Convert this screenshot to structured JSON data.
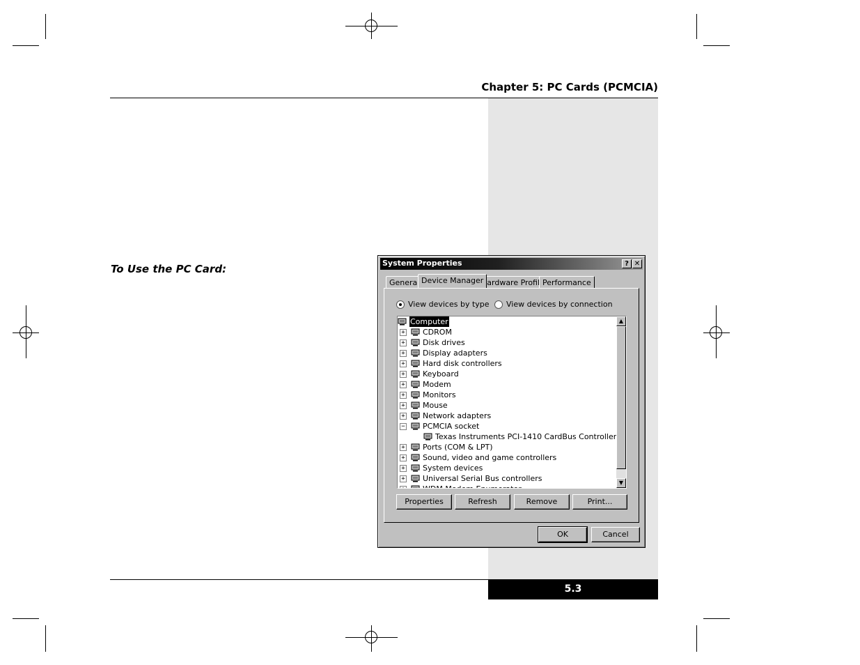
{
  "header": {
    "chapter_title": "Chapter 5: PC Cards (PCMCIA)"
  },
  "subheading": "To Use the PC Card:",
  "footer": {
    "page_number": "5.3"
  },
  "dialog": {
    "title": "System Properties",
    "help_button": "?",
    "close_button": "✕",
    "tabs": [
      "General",
      "Device Manager",
      "Hardware Profiles",
      "Performance"
    ],
    "active_tab": "Device Manager",
    "radio_by_type": "View devices by type",
    "radio_by_connection": "View devices by connection",
    "selected_radio": "View devices by type",
    "tree": [
      {
        "label": "Computer",
        "level": 0,
        "expander": "",
        "icon": "computer-icon",
        "selected": true
      },
      {
        "label": "CDROM",
        "level": 1,
        "expander": "+",
        "icon": "cdrom-icon"
      },
      {
        "label": "Disk drives",
        "level": 1,
        "expander": "+",
        "icon": "disk-drive-icon"
      },
      {
        "label": "Display adapters",
        "level": 1,
        "expander": "+",
        "icon": "display-adapter-icon"
      },
      {
        "label": "Hard disk controllers",
        "level": 1,
        "expander": "+",
        "icon": "hard-disk-controller-icon"
      },
      {
        "label": "Keyboard",
        "level": 1,
        "expander": "+",
        "icon": "keyboard-icon"
      },
      {
        "label": "Modem",
        "level": 1,
        "expander": "+",
        "icon": "modem-icon"
      },
      {
        "label": "Monitors",
        "level": 1,
        "expander": "+",
        "icon": "monitor-icon"
      },
      {
        "label": "Mouse",
        "level": 1,
        "expander": "+",
        "icon": "mouse-icon"
      },
      {
        "label": "Network adapters",
        "level": 1,
        "expander": "+",
        "icon": "network-adapter-icon"
      },
      {
        "label": "PCMCIA socket",
        "level": 1,
        "expander": "−",
        "icon": "pcmcia-icon"
      },
      {
        "label": "Texas Instruments PCI-1410 CardBus Controller",
        "level": 2,
        "expander": "",
        "icon": "pcmcia-card-icon"
      },
      {
        "label": "Ports (COM & LPT)",
        "level": 1,
        "expander": "+",
        "icon": "port-icon"
      },
      {
        "label": "Sound, video and game controllers",
        "level": 1,
        "expander": "+",
        "icon": "sound-icon"
      },
      {
        "label": "System devices",
        "level": 1,
        "expander": "+",
        "icon": "system-device-icon"
      },
      {
        "label": "Universal Serial Bus controllers",
        "level": 1,
        "expander": "+",
        "icon": "usb-icon"
      },
      {
        "label": "WDM Modem Enumerator",
        "level": 1,
        "expander": "+",
        "icon": "modem-enumerator-icon"
      }
    ],
    "buttons": {
      "properties": "Properties",
      "refresh": "Refresh",
      "remove": "Remove",
      "print": "Print...",
      "ok": "OK",
      "cancel": "Cancel"
    },
    "scroll_up": "▲",
    "scroll_down": "▼"
  }
}
